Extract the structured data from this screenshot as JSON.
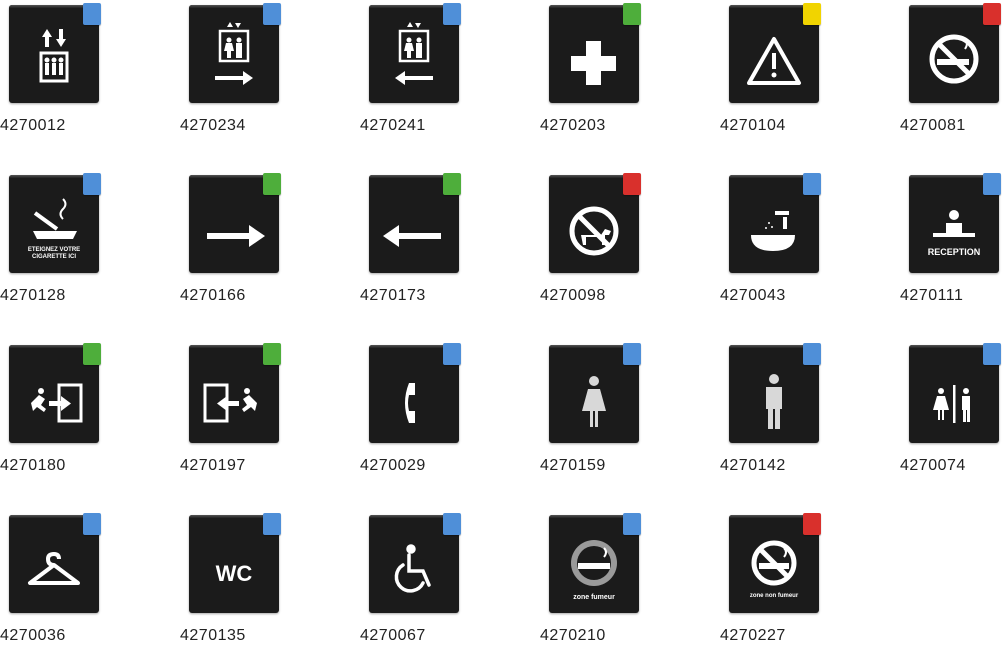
{
  "signs": [
    {
      "code": "4270012",
      "tab": "blue",
      "icon": "elevator-icon"
    },
    {
      "code": "4270234",
      "tab": "blue",
      "icon": "elevator-right-icon"
    },
    {
      "code": "4270241",
      "tab": "blue",
      "icon": "elevator-left-icon"
    },
    {
      "code": "4270203",
      "tab": "green",
      "icon": "first-aid-cross-icon"
    },
    {
      "code": "4270104",
      "tab": "yellow",
      "icon": "warning-triangle-icon"
    },
    {
      "code": "4270081",
      "tab": "red",
      "icon": "no-smoking-icon"
    },
    {
      "code": "4270128",
      "tab": "blue",
      "icon": "extinguish-cigarette-icon",
      "caption": [
        "ETEIGNEZ VOTRE",
        "CIGARETTE ICI"
      ]
    },
    {
      "code": "4270166",
      "tab": "green",
      "icon": "arrow-right-icon"
    },
    {
      "code": "4270173",
      "tab": "green",
      "icon": "arrow-left-icon"
    },
    {
      "code": "4270098",
      "tab": "red",
      "icon": "no-dogs-icon"
    },
    {
      "code": "4270043",
      "tab": "blue",
      "icon": "washbasin-icon"
    },
    {
      "code": "4270111",
      "tab": "blue",
      "icon": "reception-icon",
      "caption": [
        "RECEPTION"
      ]
    },
    {
      "code": "4270180",
      "tab": "green",
      "icon": "emergency-exit-right-icon"
    },
    {
      "code": "4270197",
      "tab": "green",
      "icon": "emergency-exit-left-icon"
    },
    {
      "code": "4270029",
      "tab": "blue",
      "icon": "telephone-icon"
    },
    {
      "code": "4270159",
      "tab": "blue",
      "icon": "woman-icon"
    },
    {
      "code": "4270142",
      "tab": "blue",
      "icon": "man-icon"
    },
    {
      "code": "4270074",
      "tab": "blue",
      "icon": "toilets-man-woman-icon"
    },
    {
      "code": "4270036",
      "tab": "blue",
      "icon": "coat-hanger-icon"
    },
    {
      "code": "4270135",
      "tab": "blue",
      "icon": "wc-icon",
      "caption": [
        "WC"
      ]
    },
    {
      "code": "4270067",
      "tab": "blue",
      "icon": "wheelchair-icon"
    },
    {
      "code": "4270210",
      "tab": "blue",
      "icon": "smoking-zone-icon",
      "caption": [
        "zone fumeur"
      ]
    },
    {
      "code": "4270227",
      "tab": "red",
      "icon": "non-smoking-zone-icon",
      "caption": [
        "zone non fumeur"
      ]
    }
  ],
  "colors": {
    "blue": "#4f8fd8",
    "green": "#4eae3b",
    "yellow": "#f1d400",
    "red": "#d9302c",
    "sign": "#1b1b1b"
  }
}
